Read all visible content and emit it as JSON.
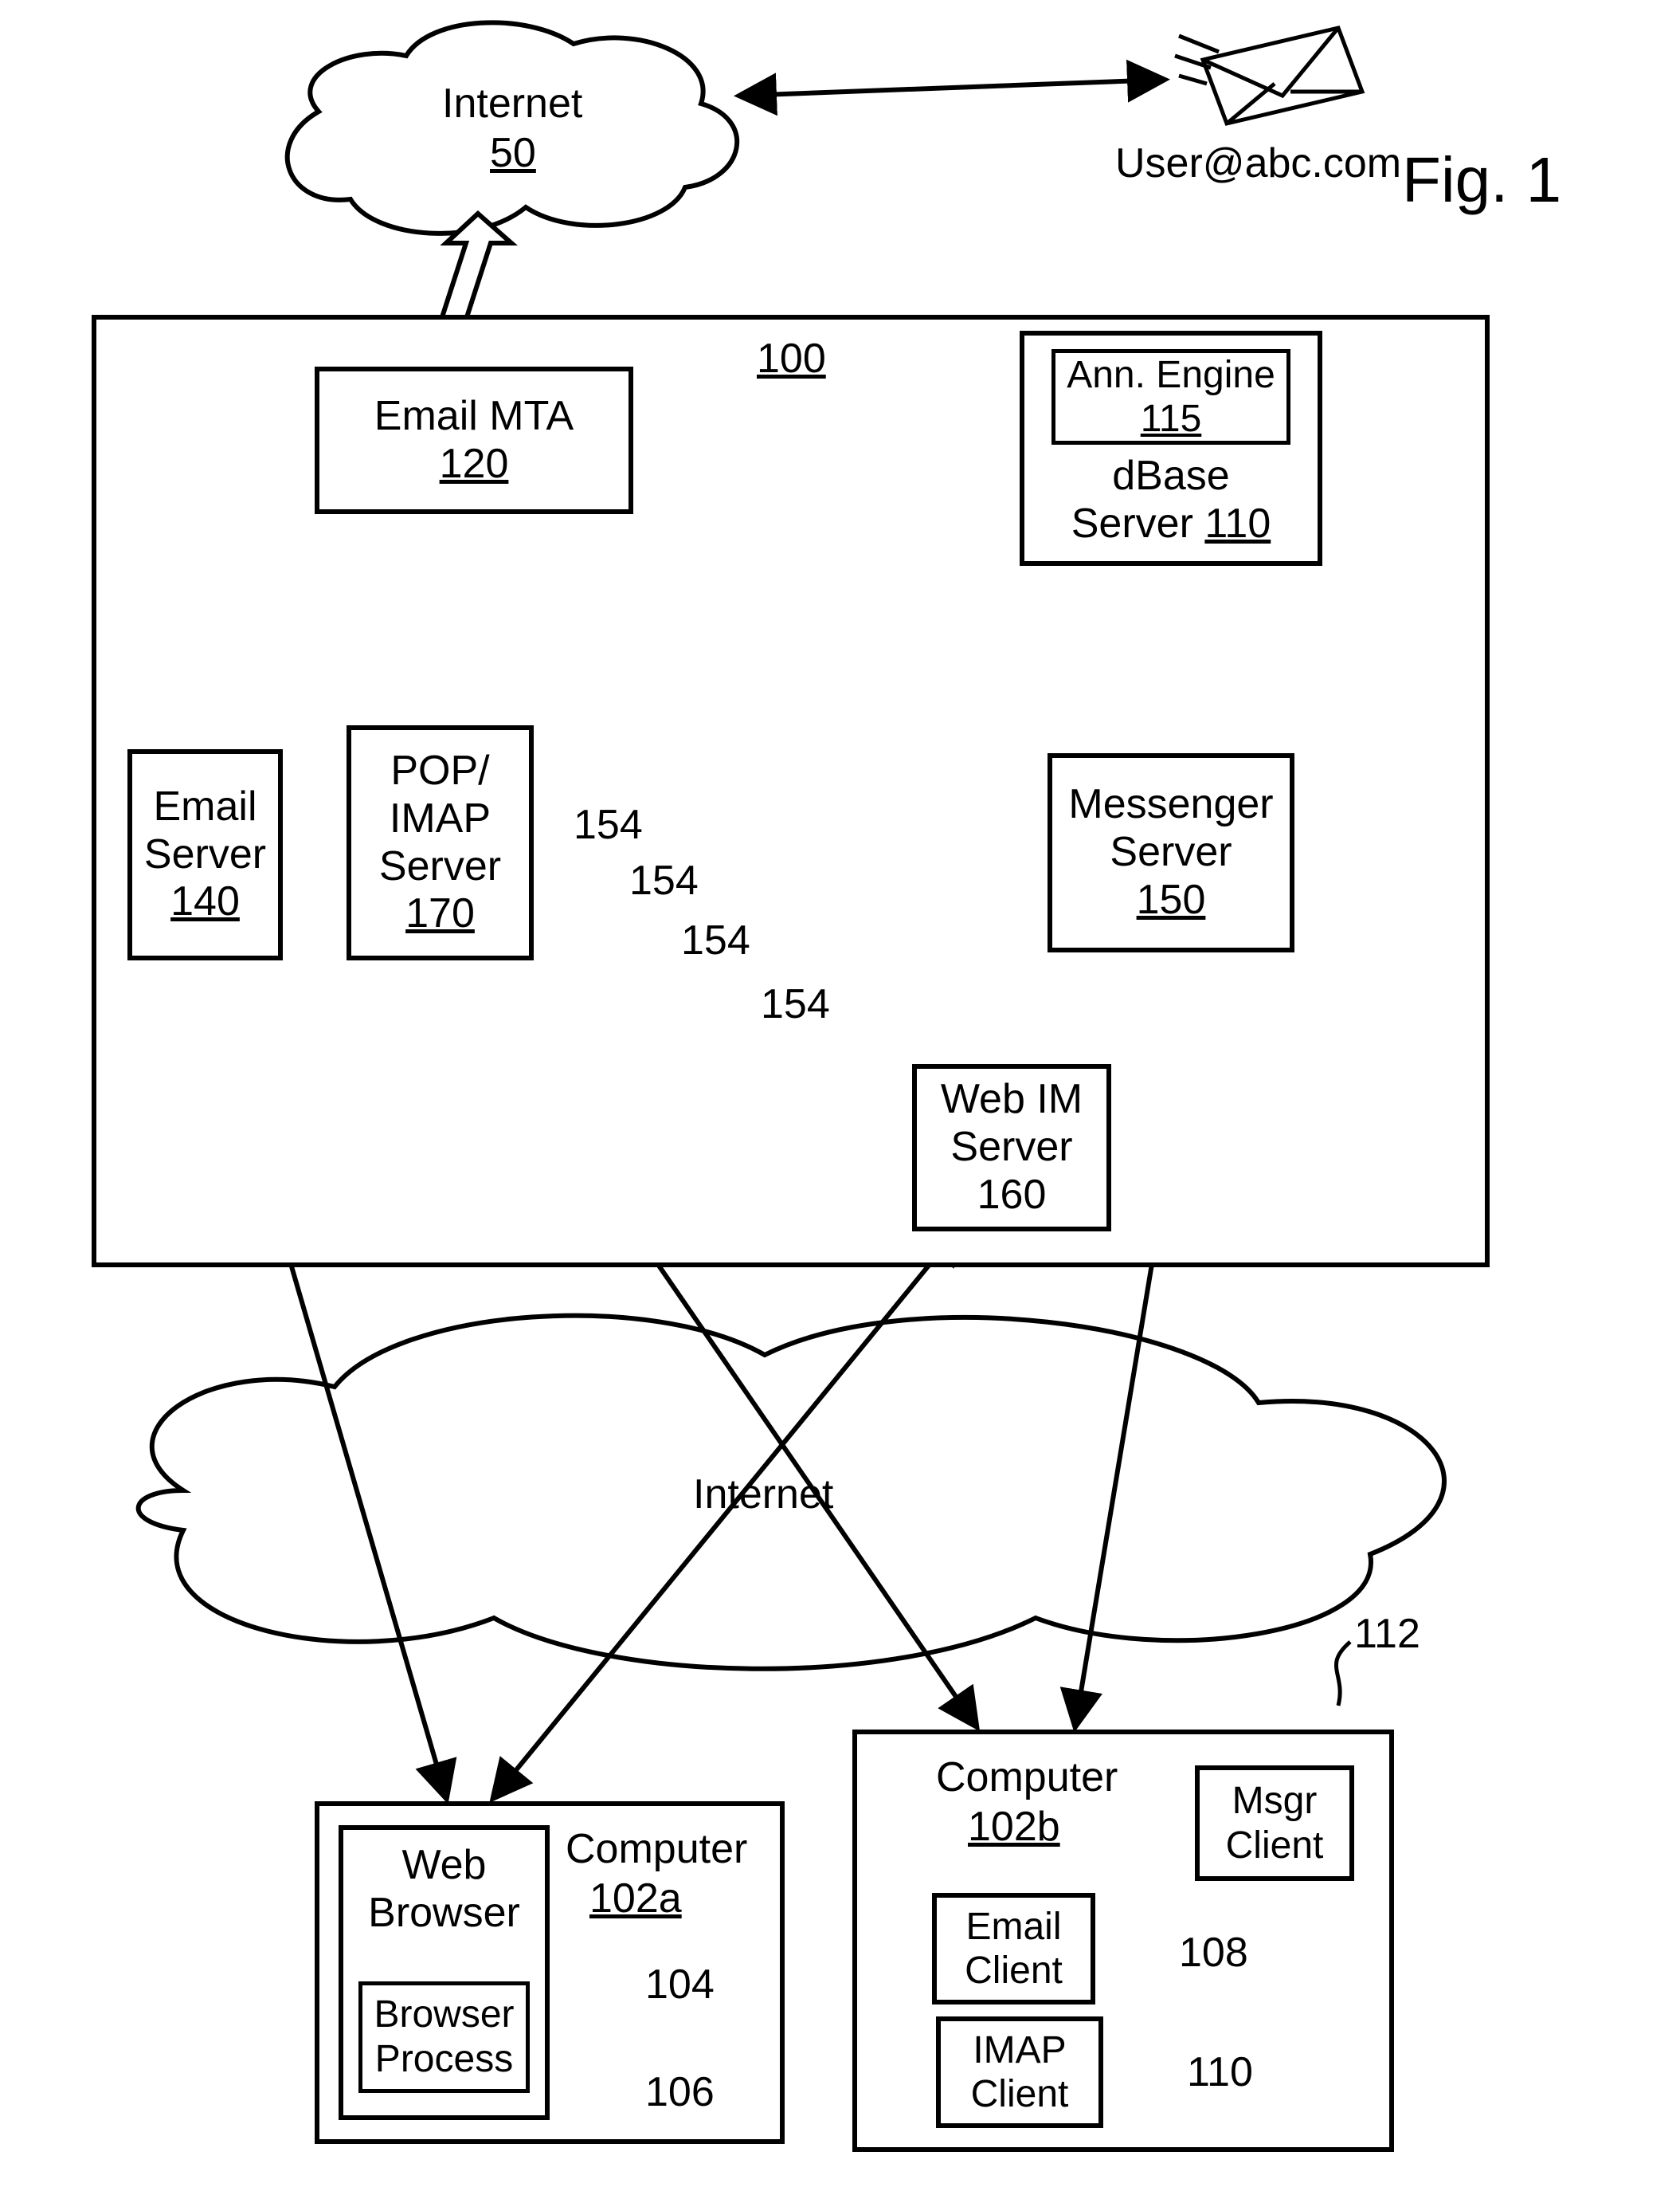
{
  "figure_label": "Fig. 1",
  "internet_top": {
    "name": "Internet",
    "num": "50"
  },
  "user_email": "User@abc.com",
  "system_num": "100",
  "email_mta": {
    "name": "Email MTA",
    "num": "120"
  },
  "dbase": {
    "ann_name": "Ann. Engine",
    "ann_num": "115",
    "name": "dBase",
    "name2": "Server",
    "num": "110"
  },
  "disk_num": "154",
  "email_server": {
    "name1": "Email",
    "name2": "Server",
    "num": "140"
  },
  "pop_imap": {
    "name1": "POP/",
    "name2": "IMAP",
    "name3": "Server",
    "num": "170"
  },
  "messenger": {
    "name1": "Messenger",
    "name2": "Server",
    "num": "150"
  },
  "web_im": {
    "name1": "Web IM",
    "name2": "Server",
    "num": "160"
  },
  "internet_mid": "Internet",
  "computer_a": {
    "title": "Computer",
    "num": "102a",
    "browser_name": "Web",
    "browser_name2": "Browser",
    "proc_name": "Browser",
    "proc_name2": "Process",
    "ref104": "104",
    "ref106": "106"
  },
  "computer_b": {
    "title": "Computer",
    "num": "102b",
    "msgr": "Msgr",
    "msgr2": "Client",
    "email_c": "Email",
    "email_c2": "Client",
    "imap_c": "IMAP",
    "imap_c2": "Client",
    "ref108": "108",
    "ref110": "110",
    "ref112": "112"
  }
}
